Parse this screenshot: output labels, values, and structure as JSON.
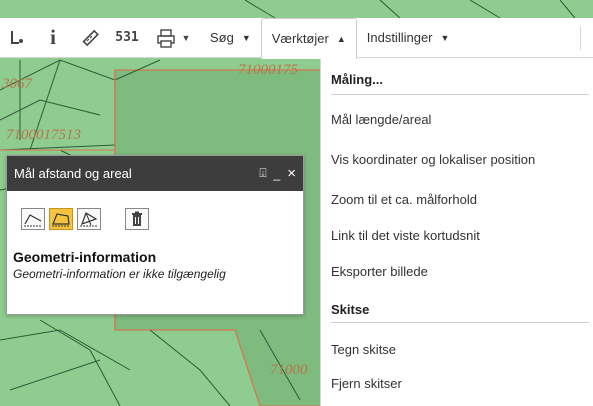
{
  "map": {
    "parcel_labels": [
      "3067",
      "71000175",
      "7100017513",
      "71000"
    ]
  },
  "toolbar": {
    "icons": [
      "layers-icon",
      "info-icon",
      "ruler-icon",
      "coordinates-icon",
      "print-icon"
    ],
    "coordinates_text": "531",
    "search_label": "Søg",
    "tools_label": "Værktøjer",
    "settings_label": "Indstillinger"
  },
  "tools_menu": {
    "measure_header": "Måling...",
    "items_measure": [
      "Mål længde/areal",
      "Vis koordinater og lokaliser position",
      "Zoom til et ca. målforhold",
      "Link til det viste kortudsnit",
      "Eksporter billede"
    ],
    "sketch_header": "Skitse",
    "items_sketch": [
      "Tegn skitse",
      "Fjern skitser"
    ]
  },
  "measure_panel": {
    "title": "Mål afstand og areal",
    "dock_glyph": "⍗",
    "minimize_glyph": "_",
    "close_glyph": "×",
    "geometry_title": "Geometri-information",
    "geometry_text": "Geometri-information er ikke tilgængelig"
  },
  "colors": {
    "map_green": "#8fcc8f",
    "parcel_orange": "#c8825a",
    "panel_header": "#3d3d3d",
    "tool_active": "#f5c542"
  }
}
